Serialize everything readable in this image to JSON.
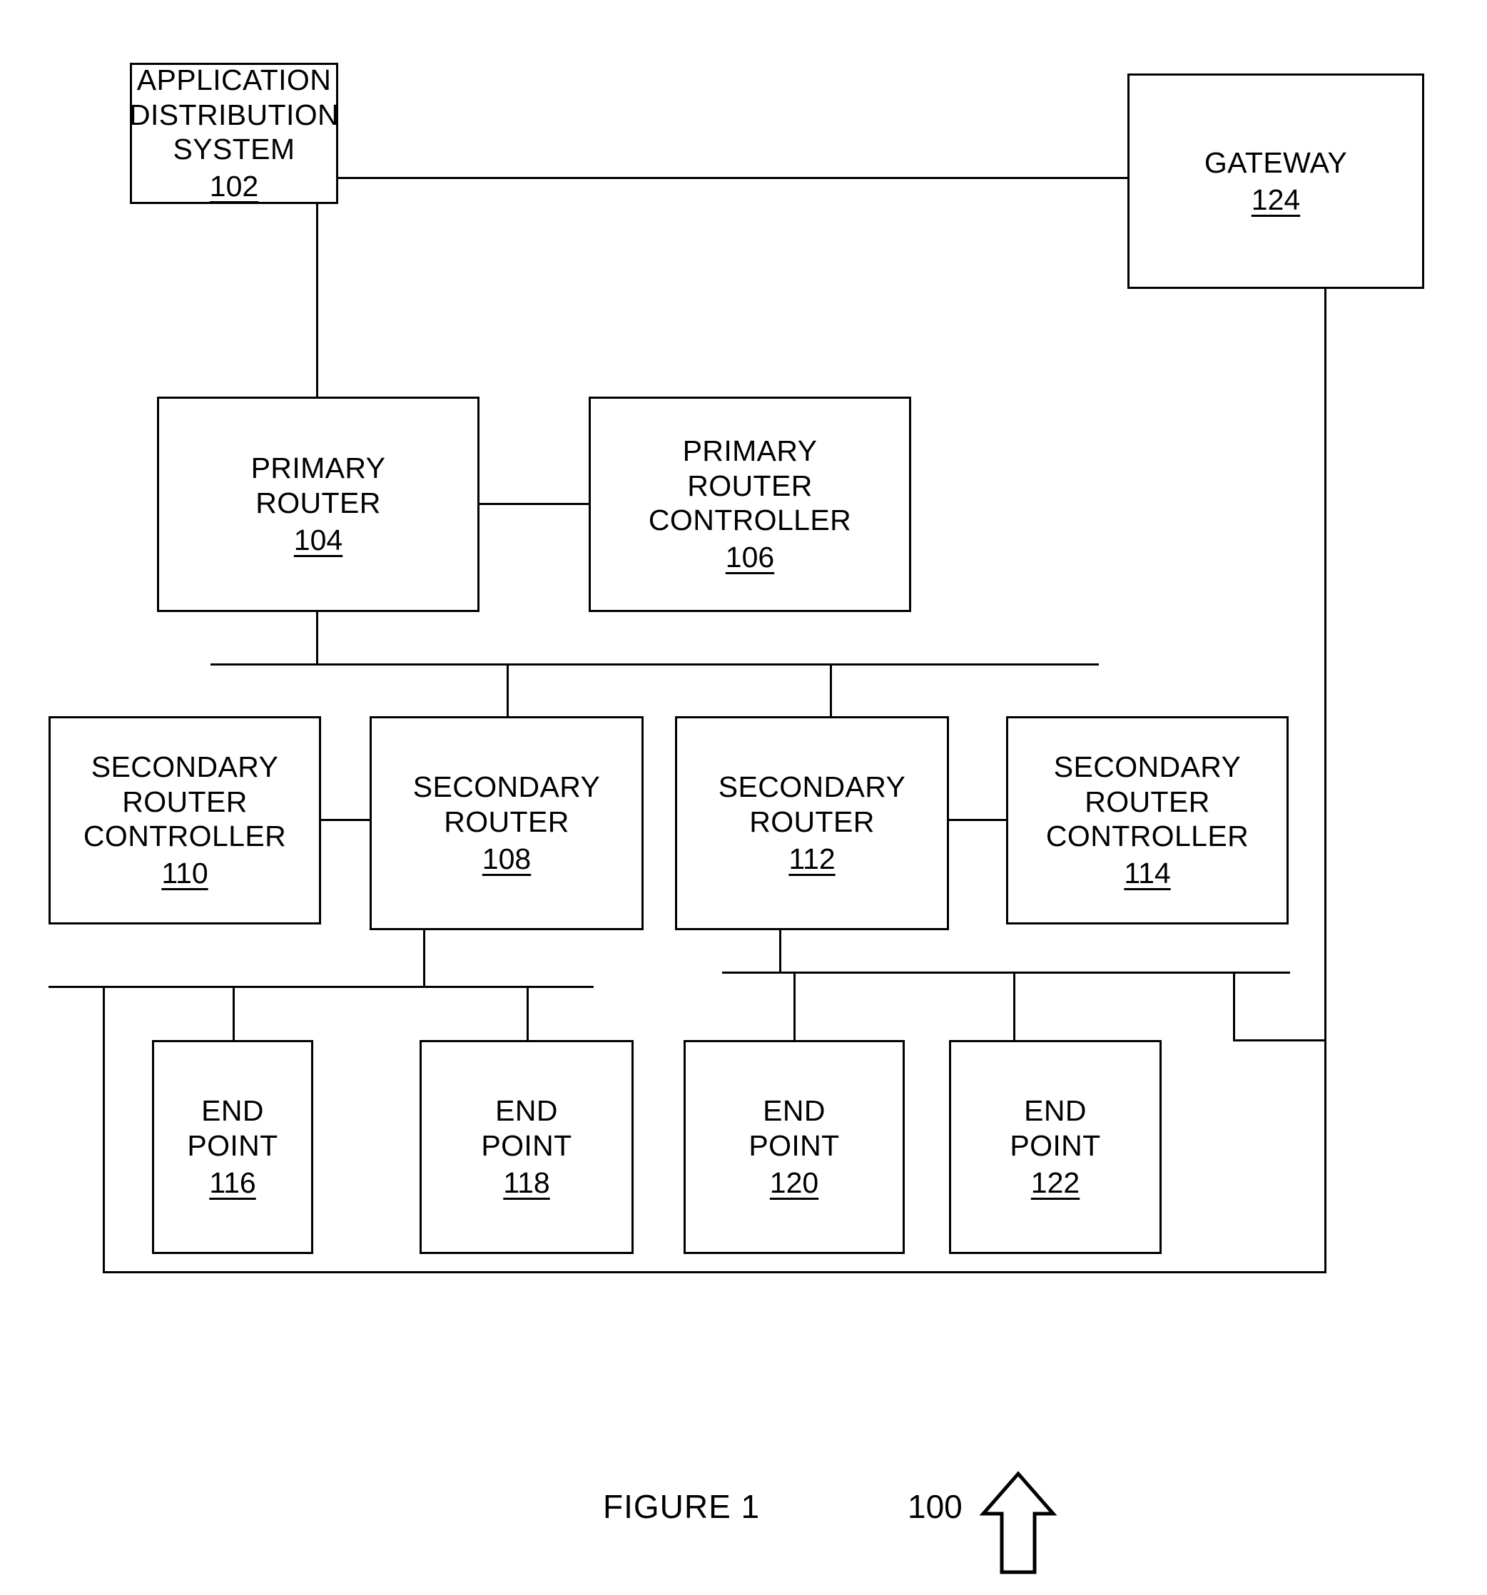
{
  "figure": {
    "caption": "FIGURE 1",
    "system_number": "100",
    "arrow_icon": "up-arrow-icon"
  },
  "nodes": [
    {
      "id": "adс",
      "key": "application-distribution-system",
      "title": "APPLICATION\nDISTRIBUTION\nSYSTEM",
      "ref": "102"
    },
    {
      "id": "gw",
      "key": "gateway",
      "title": "GATEWAY",
      "ref": "124"
    },
    {
      "id": "pr",
      "key": "primary-router",
      "title": "PRIMARY\nROUTER",
      "ref": "104"
    },
    {
      "id": "prc",
      "key": "primary-router-controller",
      "title": "PRIMARY\nROUTER\nCONTROLLER",
      "ref": "106"
    },
    {
      "id": "src110",
      "key": "secondary-router-controller-110",
      "title": "SECONDARY\nROUTER\nCONTROLLER",
      "ref": "110"
    },
    {
      "id": "sr108",
      "key": "secondary-router-108",
      "title": "SECONDARY\nROUTER",
      "ref": "108"
    },
    {
      "id": "sr112",
      "key": "secondary-router-112",
      "title": "SECONDARY\nROUTER",
      "ref": "112"
    },
    {
      "id": "src114",
      "key": "secondary-router-controller-114",
      "title": "SECONDARY\nROUTER\nCONTROLLER",
      "ref": "114"
    },
    {
      "id": "ep116",
      "key": "end-point-116",
      "title": "END\nPOINT",
      "ref": "116"
    },
    {
      "id": "ep118",
      "key": "end-point-118",
      "title": "END\nPOINT",
      "ref": "118"
    },
    {
      "id": "ep120",
      "key": "end-point-120",
      "title": "END\nPOINT",
      "ref": "120"
    },
    {
      "id": "ep122",
      "key": "end-point-122",
      "title": "END\nPOINT",
      "ref": "122"
    }
  ],
  "colors": {
    "line": "#000000",
    "background": "#ffffff"
  }
}
